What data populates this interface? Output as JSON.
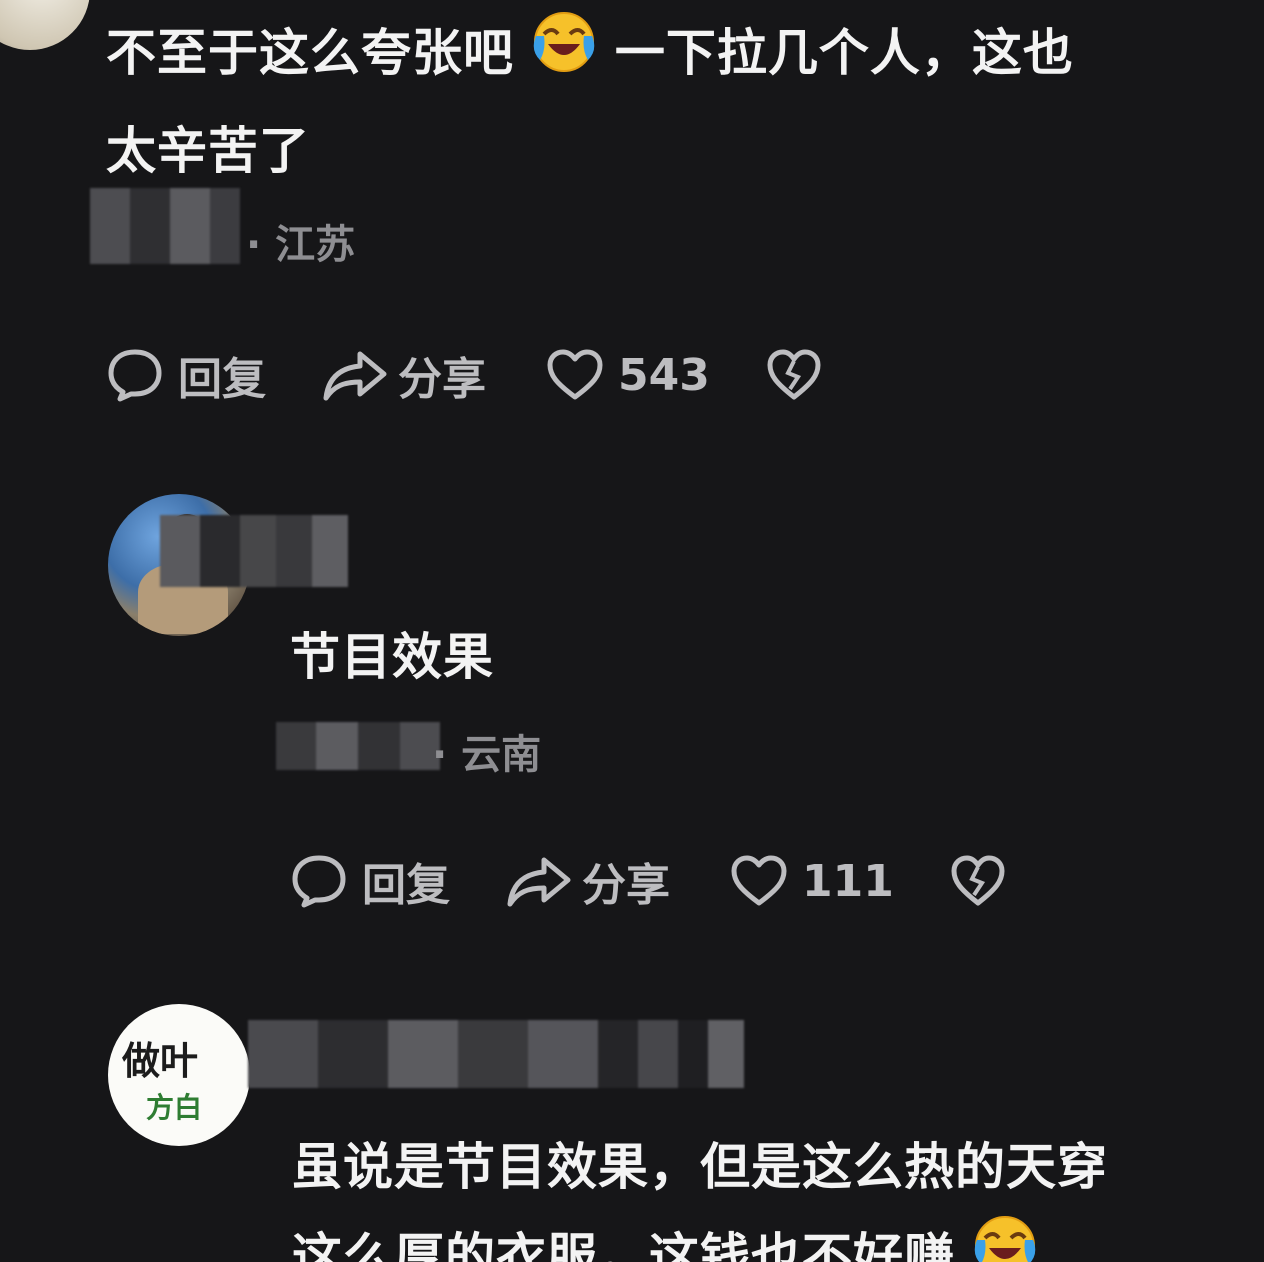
{
  "comments": [
    {
      "text_line1": "不至于这么夸张吧",
      "text_line1b": "一下拉几个人，这也",
      "text_line2": "太辛苦了",
      "location": "· 江苏",
      "actions": {
        "reply": "回复",
        "share": "分享",
        "likes": "543"
      }
    },
    {
      "text": "节目效果",
      "location": "· 云南",
      "actions": {
        "reply": "回复",
        "share": "分享",
        "likes": "111"
      }
    },
    {
      "avatar_text_1": "做叶",
      "avatar_text_2": "方白",
      "text_line1": "虽说是节目效果，但是这么热的天穿",
      "text_line2": "这么厚的衣服，这钱也不好赚"
    }
  ],
  "icons": {
    "emoji": "laughing-crying-emoji",
    "reply": "speech-bubble-icon",
    "share": "share-arrow-icon",
    "like": "heart-icon",
    "dislike": "broken-heart-icon"
  }
}
